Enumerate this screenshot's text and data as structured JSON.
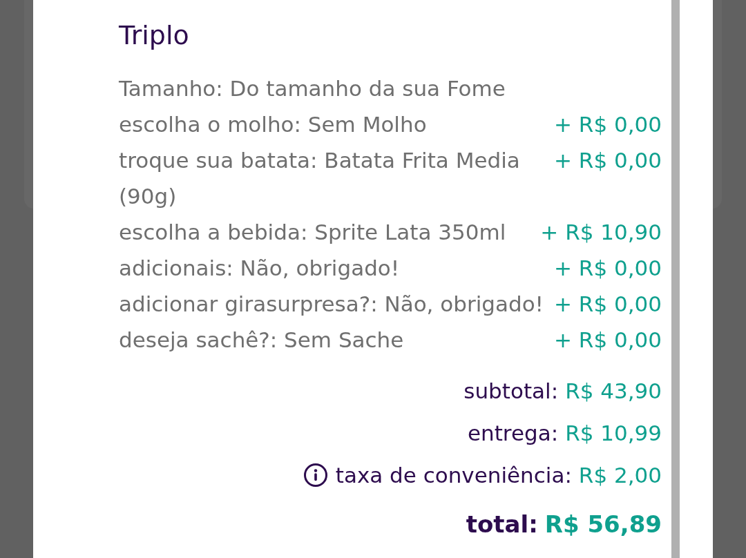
{
  "item": {
    "title": "Triplo",
    "options": [
      {
        "label": "Tamanho: Do tamanho da sua Fome"
      },
      {
        "label": "escolha o molho: Sem Molho",
        "price": "+ R$ 0,00"
      },
      {
        "label": "troque sua batata: Batata Frita Media (90g)",
        "price": "+ R$ 0,00"
      },
      {
        "label": "escolha a bebida: Sprite Lata 350ml",
        "price": "+ R$ 10,90"
      },
      {
        "label": "adicionais: Não, obrigado!",
        "price": "+ R$ 0,00"
      },
      {
        "label": "adicionar girasurpresa?: Não, obrigado!",
        "price": "+ R$ 0,00"
      },
      {
        "label": "deseja sachê?: Sem Sache",
        "price": "+ R$ 0,00"
      }
    ]
  },
  "summary": [
    {
      "kind": "line",
      "label": "subtotal:",
      "value": "R$ 43,90"
    },
    {
      "kind": "line",
      "label": "entrega:",
      "value": "R$ 10,99"
    },
    {
      "kind": "info",
      "label": "taxa de conveniência:",
      "value": "R$ 2,00"
    },
    {
      "kind": "total",
      "label": "total:",
      "value": "R$ 56,89"
    }
  ]
}
